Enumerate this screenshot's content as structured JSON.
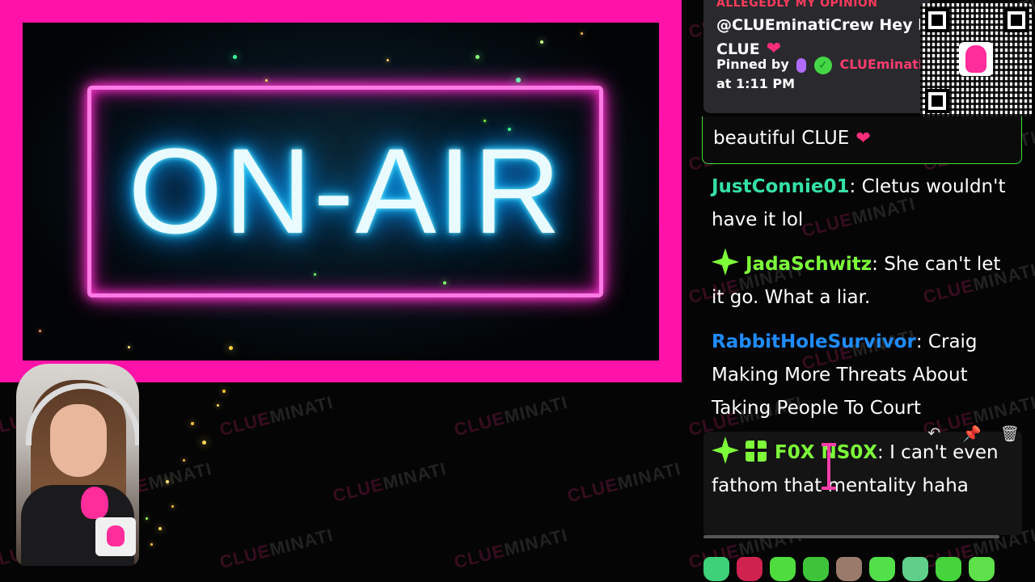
{
  "stream": {
    "sign_text": "ON-AIR",
    "watermark": {
      "part1": "CLUE",
      "part2": "MINATI"
    }
  },
  "pinned": {
    "header": "ALLEGEDLY MY OPINION",
    "message_line1": "@CLUEminatiCrew Hey be",
    "message_line2": "CLUE",
    "pinned_by_label": "Pinned by",
    "pinned_by_name": "CLUEminati",
    "time": "at 1:11 PM"
  },
  "chat": {
    "highlighted_text": "beautiful CLUE",
    "messages": [
      {
        "user": "JustConnie01",
        "color": "#34e0a8",
        "text": ": Cletus wouldn't have it lol"
      },
      {
        "user": "JadaSchwitz",
        "color": "#7dff3a",
        "text": ": She can't let it go. What a liar."
      },
      {
        "user": "RabbitHoleSurvivor",
        "color": "#1f8cff",
        "text": ": Craig Making More Threats About Taking People To Court"
      },
      {
        "user": "F0X NS0X",
        "color": "#7dff3a",
        "text": ": I can't even fathom that mentality haha"
      }
    ],
    "actions": {
      "reply": "↶",
      "pin": "📌",
      "delete": "🗑"
    }
  },
  "colors": {
    "frame": "#ff12a8",
    "neon_pink": "#ff7ae6",
    "neon_blue": "#19c6ff",
    "highlight_border": "#43e03a"
  }
}
